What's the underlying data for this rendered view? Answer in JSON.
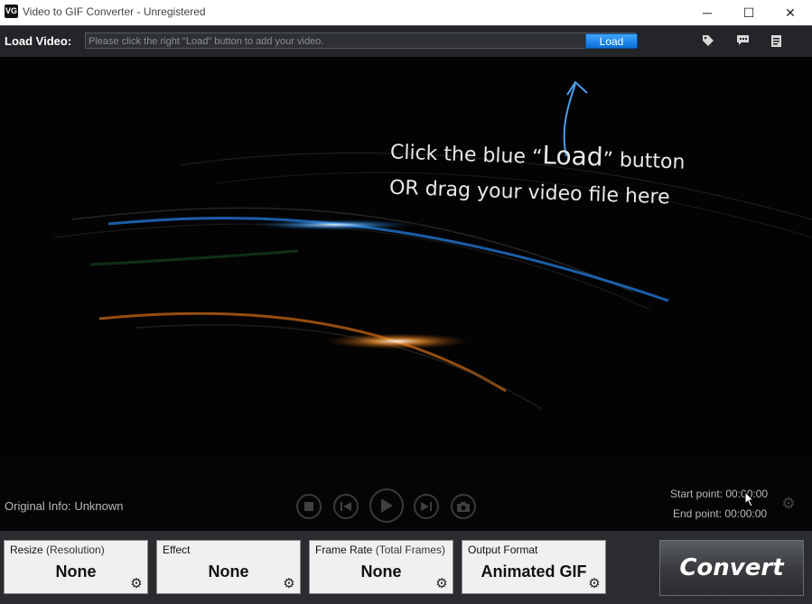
{
  "window": {
    "title": "Video to GIF Converter - Unregistered",
    "app_icon_text": "VG",
    "minimize": "─",
    "maximize": "☐",
    "close": "✕"
  },
  "loadbar": {
    "label": "Load Video:",
    "placeholder": "Please click the right \"Load\" button to add your video.",
    "load_button": "Load",
    "icons": [
      "tag-icon",
      "chat-icon",
      "notes-icon"
    ]
  },
  "preview": {
    "hint_line1_pre": "Click the blue “",
    "hint_line1_load": "Load",
    "hint_line1_post": "” button",
    "hint_line2": "OR drag your video file here"
  },
  "controls": {
    "original_info": "Original Info: Unknown",
    "start_point_label": "Start point:",
    "start_point_value": "00:00:00",
    "end_point_label": "End point:",
    "end_point_value": "00:00:00"
  },
  "panels": [
    {
      "label": "Resize",
      "label_extra": " (Resolution)",
      "value": "None"
    },
    {
      "label": "Effect",
      "label_extra": "",
      "value": "None"
    },
    {
      "label": "Frame Rate",
      "label_extra": " (Total Frames)",
      "value": "None"
    },
    {
      "label": "Output Format",
      "label_extra": "",
      "value": "Animated GIF"
    }
  ],
  "convert_button": "Convert",
  "colors": {
    "accent_blue": "#1a8cff",
    "bar_bg": "#232528",
    "panel_bg": "#f0f0f0"
  }
}
